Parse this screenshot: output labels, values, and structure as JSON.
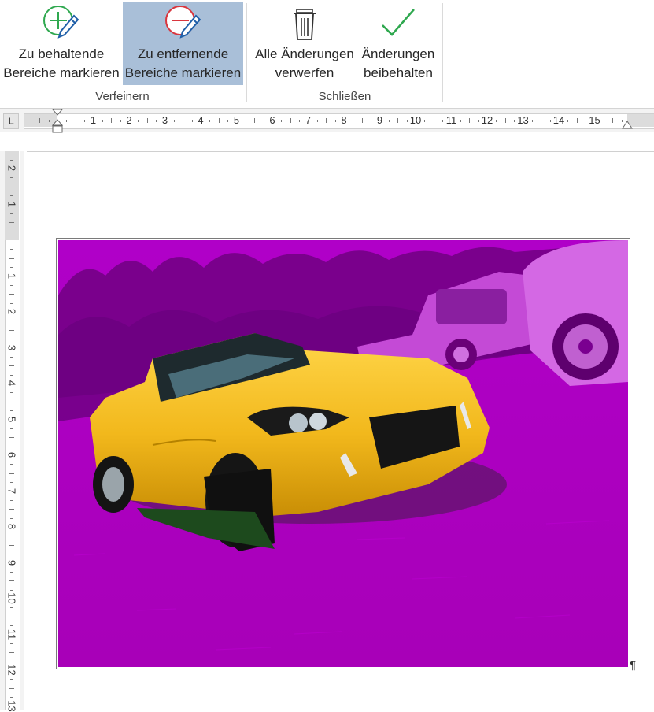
{
  "ribbon": {
    "buttons": [
      {
        "id": "keep",
        "line1": "Zu behaltende",
        "line2": "Bereiche markieren"
      },
      {
        "id": "remove",
        "line1": "Zu entfernende",
        "line2": "Bereiche markieren"
      },
      {
        "id": "discard",
        "line1": "Alle Änderungen",
        "line2": "verwerfen"
      },
      {
        "id": "keepall",
        "line1": "Änderungen",
        "line2": "beibehalten"
      }
    ],
    "groups": {
      "refine": "Verfeinern",
      "close": "Schließen"
    }
  },
  "ruler": {
    "corner": "L",
    "h_numbers": [
      "1",
      "2",
      "3",
      "4",
      "5",
      "6",
      "7",
      "8",
      "9",
      "10",
      "11",
      "12",
      "13",
      "14",
      "15"
    ],
    "v_numbers_top": [
      "2",
      "1"
    ],
    "v_numbers": [
      "1",
      "2",
      "3",
      "4",
      "5",
      "6",
      "7",
      "8",
      "9",
      "10",
      "11",
      "12",
      "13"
    ]
  },
  "document": {
    "pilcrow": "¶"
  },
  "colors": {
    "removal_overlay": "#c000c0",
    "car": "#f2b81c",
    "active_button": "#a9bfd8"
  }
}
